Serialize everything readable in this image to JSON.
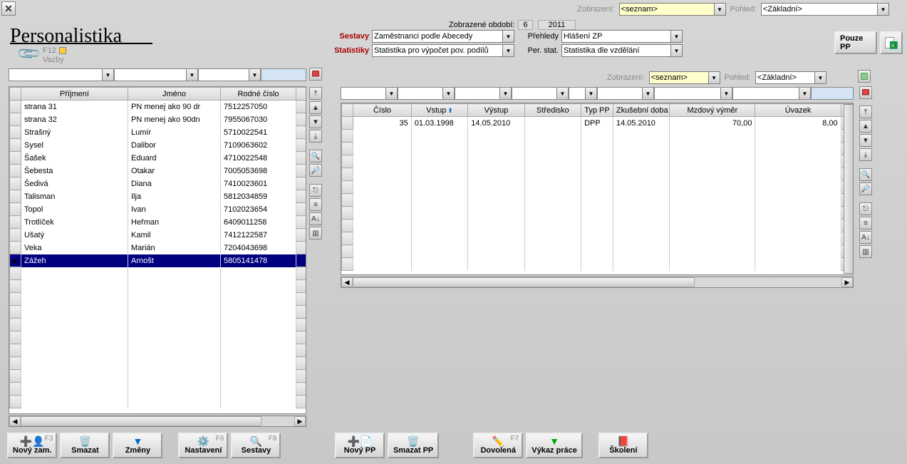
{
  "top": {
    "zobrazeni_label": "Zobrazení:",
    "zobrazeni_value": "<seznam>",
    "pohled_label": "Pohled:",
    "pohled_value": "<Základní>"
  },
  "title": "Personalistika",
  "f12": "F12",
  "vazby": "Vazby",
  "period": {
    "label": "Zobrazené období:",
    "month": "6",
    "year": "2011"
  },
  "sets": {
    "sestavy_label": "Sestavy",
    "sestavy_value": "Zaměstnanci podle Abecedy",
    "prehledy_label": "Přehledy",
    "prehledy_value": "Hlášení ZP",
    "statistiky_label": "Statistiky",
    "statistiky_value": "Statistika pro výpočet pov. podílů",
    "perstat_label": "Per. stat.",
    "perstat_value": "Statistika dle vzdělání"
  },
  "pouze_pp": "Pouze PP",
  "sub": {
    "zobrazeni_label": "Zobrazení:",
    "zobrazeni_value": "<seznam>",
    "pohled_label": "Pohled:",
    "pohled_value": "<Základní>"
  },
  "left_table": {
    "headers": [
      "Příjmení",
      "Jméno",
      "Rodné číslo"
    ],
    "rows": [
      {
        "c": [
          "strana 31",
          "PN menej ako 90 dr",
          "7512257050"
        ]
      },
      {
        "c": [
          "strana 32",
          "PN menej ako 90dn",
          "7955067030"
        ]
      },
      {
        "c": [
          "Strašný",
          "Lumír",
          "5710022541"
        ]
      },
      {
        "c": [
          "Sysel",
          "Dalibor",
          "7109063602"
        ]
      },
      {
        "c": [
          "Šašek",
          "Eduard",
          "4710022548"
        ]
      },
      {
        "c": [
          "Šebesta",
          "Otakar",
          "7005053698"
        ]
      },
      {
        "c": [
          "Šedivá",
          "Diana",
          "7410023601"
        ]
      },
      {
        "c": [
          "Talisman",
          "Ilja",
          "5812034859"
        ]
      },
      {
        "c": [
          "Topol",
          "Ivan",
          "7102023654"
        ]
      },
      {
        "c": [
          "Trotlíček",
          "Heřman",
          "6409011258"
        ]
      },
      {
        "c": [
          "Ušatý",
          "Kamil",
          "7412122587"
        ]
      },
      {
        "c": [
          "Veka",
          "Marián",
          "7204043698"
        ]
      },
      {
        "c": [
          "Zážeh",
          "Arnošt",
          "5805141478"
        ],
        "sel": true
      }
    ],
    "blank_rows": 11
  },
  "right_table": {
    "headers": [
      "Číslo",
      "Vstup",
      "Výstup",
      "Středisko",
      "Typ PP",
      "Zkušební doba",
      "Mzdový výměr",
      "Úvazek"
    ],
    "sort_col": 1,
    "rows": [
      {
        "c": [
          "35",
          "01.03.1998",
          "14.05.2010",
          "",
          "DPP",
          "14.05.2010",
          "70,00",
          "8,00"
        ]
      }
    ],
    "blank_rows": 11
  },
  "buttons": {
    "novy_zam": {
      "label": "Nový zam.",
      "hk": "F3"
    },
    "smazat": {
      "label": "Smazat"
    },
    "zmeny": {
      "label": "Změny"
    },
    "nastaveni": {
      "label": "Nastavení",
      "hk": "F6"
    },
    "sestavy": {
      "label": "Sestavy",
      "hk": "F8"
    },
    "novy_pp": {
      "label": "Nový PP"
    },
    "smazat_pp": {
      "label": "Smazat PP"
    },
    "dovolena": {
      "label": "Dovolená",
      "hk": "F7"
    },
    "vykaz": {
      "label": "Výkaz práce"
    },
    "skoleni": {
      "label": "Školení"
    }
  }
}
